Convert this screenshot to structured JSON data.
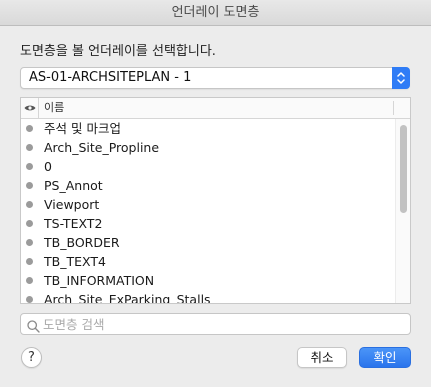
{
  "window": {
    "title": "언더레이 도면층"
  },
  "prompt": "도면층을 볼 언더레이를 선택합니다.",
  "underlay_select": {
    "value": "AS-01-ARCHSITEPLAN - 1"
  },
  "layer_list": {
    "header": {
      "visibility_icon": "eye-icon",
      "name_column": "이름"
    },
    "rows": [
      {
        "label": "주석 및 마크업"
      },
      {
        "label": "Arch_Site_Propline"
      },
      {
        "label": "0"
      },
      {
        "label": "PS_Annot"
      },
      {
        "label": "Viewport"
      },
      {
        "label": "TS-TEXT2"
      },
      {
        "label": "TB_BORDER"
      },
      {
        "label": "TB_TEXT4"
      },
      {
        "label": "TB_INFORMATION"
      },
      {
        "label": "Arch_Site_ExParking_Stalls"
      }
    ]
  },
  "search": {
    "placeholder": "도면층 검색",
    "value": ""
  },
  "buttons": {
    "help": "?",
    "cancel": "취소",
    "ok": "확인"
  },
  "colors": {
    "accent": "#2f7cf6",
    "dot": "#9b9b9b"
  }
}
